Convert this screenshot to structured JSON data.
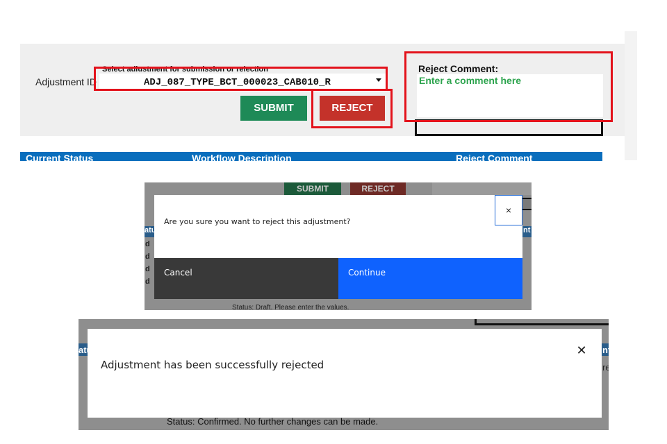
{
  "panel1": {
    "adjustment_label": "Adjustment ID",
    "select_hint": "Select adjustment for submission or rejection",
    "selected_adjustment": "ADJ_087_TYPE_BCT_000023_CAB010_R",
    "submit_label": "SUBMIT",
    "reject_label": "REJECT",
    "reject_comment_label": "Reject Comment:",
    "comment_placeholder": "Enter a comment here",
    "table_headers": [
      "Current Status",
      "Workflow Description",
      "Reject Comment"
    ],
    "colors": {
      "submit": "#1e8a57",
      "reject": "#c4322a",
      "header": "#0a6ebd",
      "highlight": "#e3121b",
      "placeholder": "#2da44e"
    }
  },
  "panel2": {
    "bg_submit_label": "SUBMIT",
    "bg_reject_label": "REJECT",
    "bg_fragments": [
      "atu",
      "nt",
      "d",
      "d",
      "d",
      "d"
    ],
    "dialog": {
      "message": "Are you sure you want to reject this adjustment?",
      "close_glyph": "×",
      "cancel_label": "Cancel",
      "continue_label": "Continue"
    },
    "status_text": "Status: Draft. Please enter the values.",
    "colors": {
      "cancel": "#393939",
      "continue": "#0f62fe"
    }
  },
  "panel3": {
    "bg_fragments": [
      "atu",
      "nt",
      "re"
    ],
    "dialog": {
      "message": "Adjustment has been successfully rejected",
      "close_glyph": "✕"
    },
    "status_text": "Status: Confirmed. No further changes can be made."
  }
}
